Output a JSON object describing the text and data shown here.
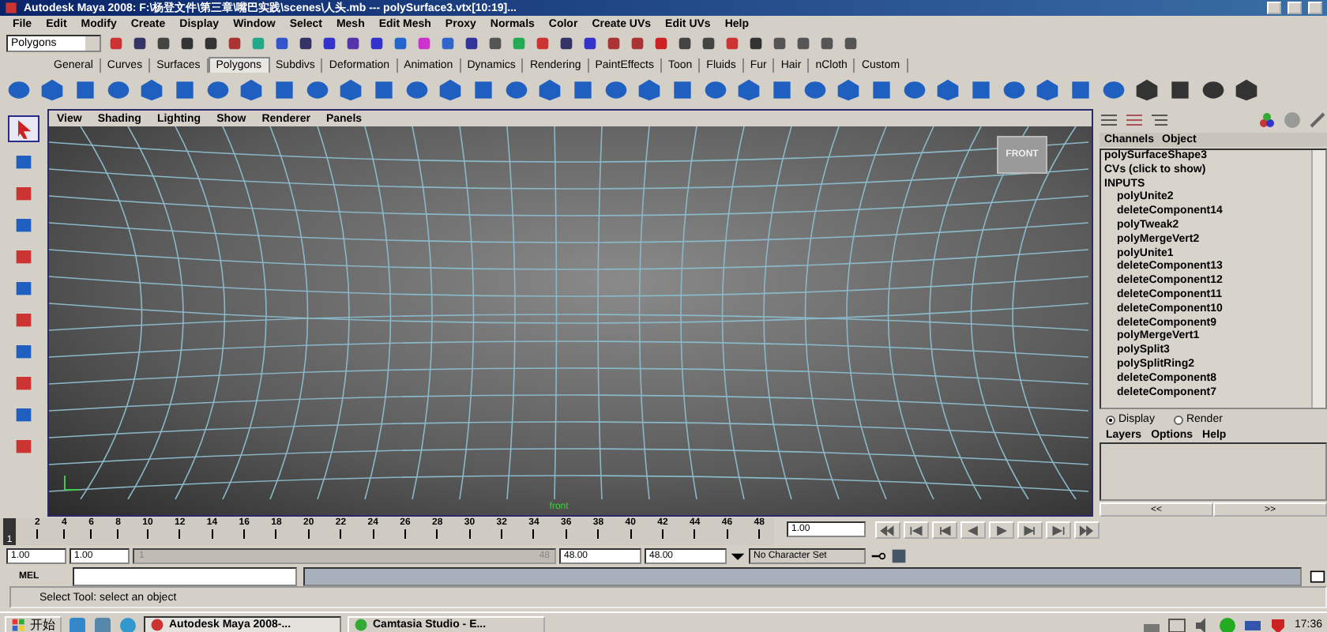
{
  "window": {
    "title": "Autodesk Maya 2008: F:\\杨登文件\\第三章\\嘴巴实践\\scenes\\人头.mb --- polySurface3.vtx[10:19]..."
  },
  "menu": [
    "File",
    "Edit",
    "Modify",
    "Create",
    "Display",
    "Window",
    "Select",
    "Mesh",
    "Edit Mesh",
    "Proxy",
    "Normals",
    "Color",
    "Create UVs",
    "Edit UVs",
    "Help"
  ],
  "mode_menu": {
    "value": "Polygons"
  },
  "shelf_tabs": [
    {
      "label": "General",
      "selected": false
    },
    {
      "label": "Curves",
      "selected": false
    },
    {
      "label": "Surfaces",
      "selected": false
    },
    {
      "label": "Polygons",
      "selected": true
    },
    {
      "label": "Subdivs",
      "selected": false
    },
    {
      "label": "Deformation",
      "selected": false
    },
    {
      "label": "Animation",
      "selected": false
    },
    {
      "label": "Dynamics",
      "selected": false
    },
    {
      "label": "Rendering",
      "selected": false
    },
    {
      "label": "PaintEffects",
      "selected": false
    },
    {
      "label": "Toon",
      "selected": false
    },
    {
      "label": "Fluids",
      "selected": false
    },
    {
      "label": "Fur",
      "selected": false
    },
    {
      "label": "Hair",
      "selected": false
    },
    {
      "label": "nCloth",
      "selected": false
    },
    {
      "label": "Custom",
      "selected": false
    }
  ],
  "tools": [
    {
      "selected": true
    },
    {
      "selected": false
    },
    {
      "selected": false
    },
    {
      "selected": false
    },
    {
      "selected": false
    },
    {
      "selected": false
    },
    {
      "selected": false
    },
    {
      "selected": false
    },
    {
      "selected": false
    },
    {
      "selected": false
    },
    {
      "selected": false
    }
  ],
  "viewport": {
    "menu": [
      "View",
      "Shading",
      "Lighting",
      "Show",
      "Renderer",
      "Panels"
    ],
    "view_cube_label": "FRONT",
    "camera_label": "front"
  },
  "channel_box": {
    "tabs": [
      "Channels",
      "Object"
    ],
    "shape": "polySurfaceShape3",
    "cvs": "CVs (click to show)",
    "inputs_header": "INPUTS",
    "inputs": [
      "polyUnite2",
      "deleteComponent14",
      "polyTweak2",
      "polyMergeVert2",
      "polyUnite1",
      "deleteComponent13",
      "deleteComponent12",
      "deleteComponent11",
      "deleteComponent10",
      "deleteComponent9",
      "polyMergeVert1",
      "polySplit3",
      "polySplitRing2",
      "deleteComponent8",
      "deleteComponent7"
    ]
  },
  "layer_editor": {
    "modes": [
      {
        "label": "Display",
        "selected": true
      },
      {
        "label": "Render",
        "selected": false
      }
    ],
    "menu": [
      "Layers",
      "Options",
      "Help"
    ],
    "nav": [
      "<<",
      ">>"
    ]
  },
  "timeline": {
    "ticks": [
      "2",
      "4",
      "6",
      "8",
      "10",
      "12",
      "14",
      "16",
      "18",
      "20",
      "22",
      "24",
      "26",
      "28",
      "30",
      "32",
      "34",
      "36",
      "38",
      "40",
      "42",
      "44",
      "46",
      "48"
    ],
    "current_frame": "1",
    "current_field": "1.00",
    "level": 0
  },
  "range": {
    "start": "1.00",
    "inner_start": "1.00",
    "range_start": "1",
    "range_end": "48",
    "level": 1,
    "inner_end": "48.00",
    "end": "48.00",
    "character_set": "No Character Set"
  },
  "command_line": {
    "label": "MEL"
  },
  "help_line": "Select Tool: select an object",
  "taskbar": {
    "start": "开始",
    "tasks": [
      {
        "label": "Autodesk Maya 2008-...",
        "selected": true
      },
      {
        "label": "Camtasia Studio - E...",
        "selected": false
      }
    ],
    "clock": "17:36"
  }
}
